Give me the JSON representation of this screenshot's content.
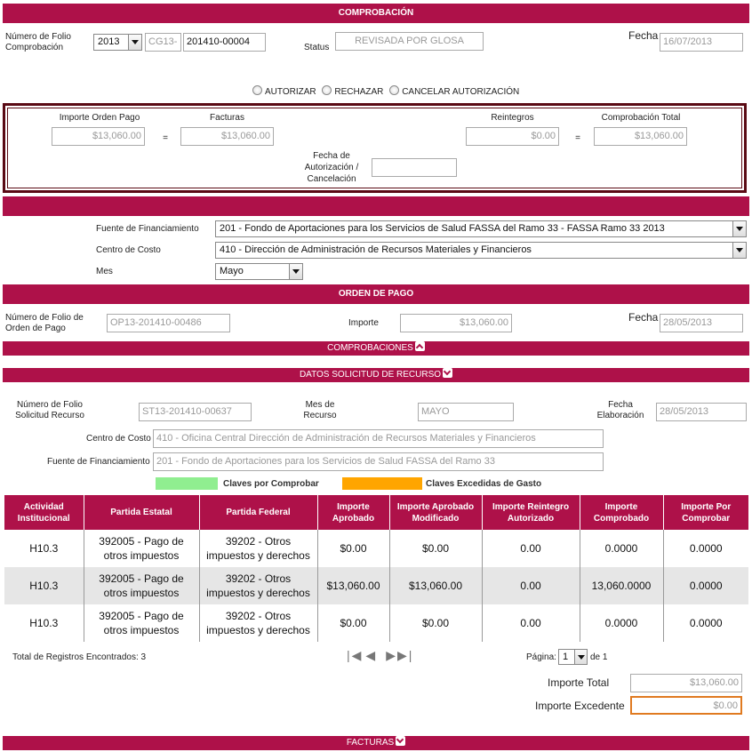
{
  "comprobacion": {
    "title": "COMPROBACIÓN",
    "folio_label": "Número de Folio Comprobación",
    "folio_year": "2013",
    "folio_prefix": "CG13-",
    "folio_number": "201410-00004",
    "status_label": "Status",
    "status_value": "REVISADA POR GLOSA",
    "fecha_label": "Fecha",
    "fecha_value": "16/07/2013",
    "radio_autorizar": "AUTORIZAR",
    "radio_rechazar": "RECHAZAR",
    "radio_cancelar": "CANCELAR AUTORIZACIÓN"
  },
  "totals_box": {
    "importe_orden_label": "Importe Orden Pago",
    "importe_orden_value": "$13,060.00",
    "equals1": "=",
    "facturas_label": "Facturas",
    "facturas_value": "$13,060.00",
    "reintegros_label": "Reintegros",
    "reintegros_value": "$0.00",
    "equals2": "=",
    "comprobacion_total_label": "Comprobación Total",
    "comprobacion_total_value": "$13,060.00",
    "fecha_autorizacion_label": "Fecha de Autorización / Cancelación",
    "fecha_autorizacion_value": ""
  },
  "filters": {
    "fuente_label": "Fuente de Financiamiento",
    "fuente_value": "201 - Fondo de Aportaciones para los Servicios de Salud FASSA del Ramo 33 - FASSA Ramo 33 2013",
    "centro_label": "Centro de Costo",
    "centro_value": "410 - Dirección de Administración de Recursos Materiales y Financieros",
    "mes_label": "Mes",
    "mes_value": "Mayo"
  },
  "orden_pago": {
    "title": "ORDEN DE PAGO",
    "folio_label": "Número de Folio de Orden de Pago",
    "folio_value": "OP13-201410-00486",
    "importe_label": "Importe",
    "importe_value": "$13,060.00",
    "fecha_label": "Fecha",
    "fecha_value": "28/05/2013"
  },
  "comprobaciones": {
    "title": "COMPROBACIONES"
  },
  "solicitud": {
    "title": "DATOS SOLICITUD DE RECURSO",
    "folio_label": "Número de Folio Solicitud Recurso",
    "folio_value": "ST13-201410-00637",
    "mes_label": "Mes de Recurso",
    "mes_value": "MAYO",
    "fecha_label": "Fecha Elaboración",
    "fecha_value": "28/05/2013",
    "centro_label": "Centro de Costo",
    "centro_value": "410 - Oficina Central Dirección de Administración de Recursos Materiales y Financieros",
    "fuente_label": "Fuente de Financiamiento",
    "fuente_value": "201 - Fondo de Aportaciones para los Servicios de Salud FASSA del Ramo 33",
    "legend_green": "Claves por Comprobar",
    "legend_orange": "Claves Excedidas de Gasto",
    "color_green": "#90ee90",
    "color_orange": "#ffa500"
  },
  "table": {
    "headers": [
      "Actividad Institucional",
      "Partida Estatal",
      "Partida Federal",
      "Importe Aprobado",
      "Importe Aprobado Modificado",
      "Importe Reintegro Autorizado",
      "Importe Comprobado",
      "Importe Por Comprobar"
    ],
    "rows": [
      [
        "H10.3",
        "392005 - Pago de otros impuestos",
        "39202 - Otros impuestos y derechos",
        "$0.00",
        "$0.00",
        "0.00",
        "0.0000",
        "0.0000"
      ],
      [
        "H10.3",
        "392005 - Pago de otros impuestos",
        "39202 - Otros impuestos y derechos",
        "$13,060.00",
        "$13,060.00",
        "0.00",
        "13,060.0000",
        "0.0000"
      ],
      [
        "H10.3",
        "392005 - Pago de otros impuestos",
        "39202 - Otros impuestos y derechos",
        "$0.00",
        "$0.00",
        "0.00",
        "0.0000",
        "0.0000"
      ]
    ]
  },
  "footer": {
    "total_registros": "Total de Registros Encontrados: 3",
    "pagina_label": "Página:",
    "pagina_value": "1",
    "de_label": "de 1",
    "importe_total_label": "Importe Total",
    "importe_total_value": "$13,060.00",
    "importe_excedente_label": "Importe Excedente",
    "importe_excedente_value": "$0.00"
  },
  "facturas": {
    "title": "FACTURAS"
  },
  "colors": {
    "brand": "#ae1149",
    "box_border": "#5a0a14",
    "highlight_border": "#e07a20"
  }
}
